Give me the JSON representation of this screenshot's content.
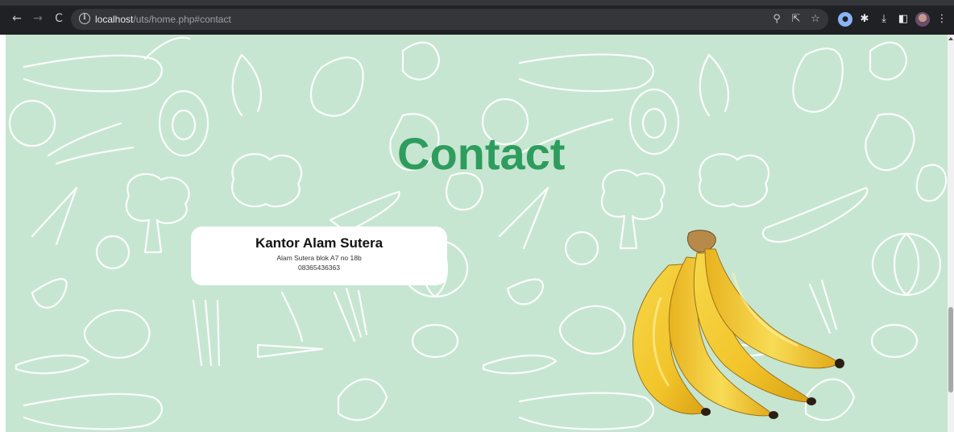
{
  "browser": {
    "url_host": "localhost",
    "url_path": "/uts/home.php#contact",
    "icons": {
      "back": "arrow-left-icon",
      "forward": "arrow-right-icon",
      "reload": "reload-icon",
      "site_info": "info-icon",
      "zoom": "zoom-icon",
      "share": "share-icon",
      "bookmark": "star-icon",
      "extension": "extension-icon",
      "puzzle": "puzzle-icon",
      "download": "download-icon",
      "sidepanel": "side-panel-icon",
      "profile": "avatar",
      "menu": "kebab-menu-icon"
    }
  },
  "page": {
    "section_title": "Contact",
    "office": {
      "name": "Kantor Alam Sutera",
      "address": "Alam Sutera blok A7 no 18b",
      "phone": "08365436363"
    },
    "colors": {
      "background": "#c6e6d1",
      "title": "#2e9c5d",
      "card": "#ffffff",
      "doodle": "#ffffff"
    },
    "image": "banana-bunch"
  }
}
